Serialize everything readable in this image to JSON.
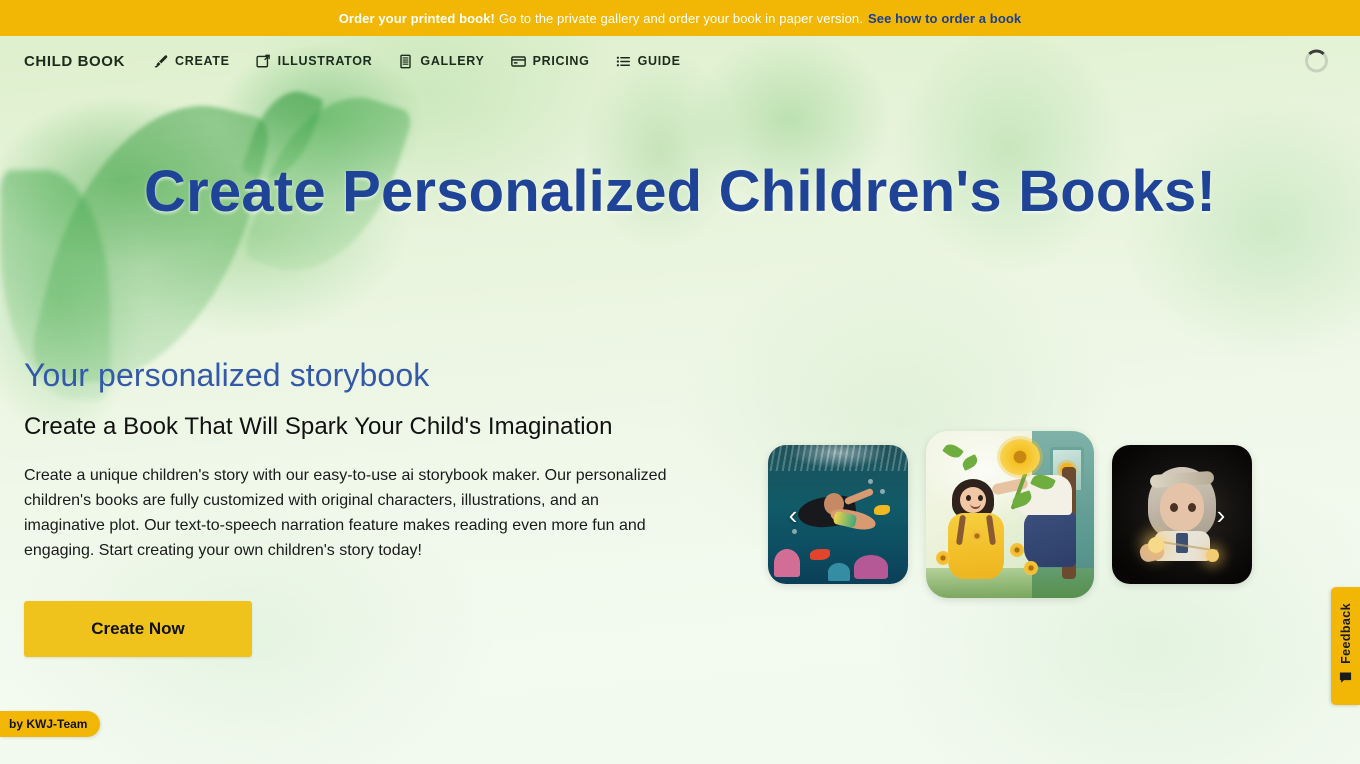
{
  "promo": {
    "strong": "Order your printed book!",
    "plain": "Go to the private gallery and order your book in paper version.",
    "link": "See how to order a book"
  },
  "nav": {
    "brand": "CHILD BOOK",
    "items": [
      {
        "label": "CREATE",
        "icon": "paintbrush-icon"
      },
      {
        "label": "ILLUSTRATOR",
        "icon": "image-edit-icon"
      },
      {
        "label": "GALLERY",
        "icon": "book-list-icon"
      },
      {
        "label": "PRICING",
        "icon": "credit-card-icon"
      },
      {
        "label": "GUIDE",
        "icon": "list-icon"
      }
    ],
    "spinner": "loading-spinner"
  },
  "hero": {
    "title": "Create Personalized Children's Books!"
  },
  "main": {
    "eyebrow": "Your personalized storybook",
    "heading": "Create a Book That Will Spark Your Child's Imagination",
    "body": "Create a unique children's story with our easy-to-use ai storybook maker. Our personalized children's books are fully customized with original characters, illustrations, and an imaginative plot. Our text-to-speech narration feature makes reading even more fun and engaging. Start creating your own children's story today!",
    "cta": "Create Now"
  },
  "carousel": {
    "prev_icon": "chevron-left-icon",
    "next_icon": "chevron-right-icon",
    "prev_glyph": "‹",
    "next_glyph": "›",
    "slides": [
      {
        "name": "slide-girl-underwater"
      },
      {
        "name": "slide-girl-sunflower"
      },
      {
        "name": "slide-girl-lantern"
      }
    ]
  },
  "feedback": {
    "label": "Feedback",
    "icon": "speech-bubble-icon"
  },
  "credit": {
    "label": "by KWJ-Team"
  },
  "colors": {
    "banner_yellow": "#f2b705",
    "button_yellow": "#f0c31c",
    "heading_blue": "#1f4396",
    "eyebrow_blue": "#3359a8",
    "link_blue": "#1b3f8f",
    "bg_green": "#eef6e4"
  }
}
